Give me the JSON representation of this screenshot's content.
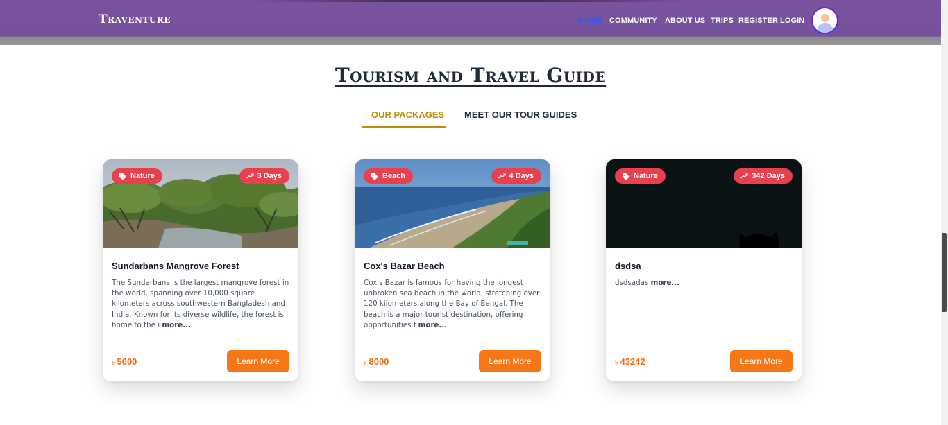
{
  "navbar": {
    "brand": "Traventure",
    "links": [
      "HOME",
      "COMMUNITY",
      "ABOUT US",
      "TRIPS",
      "REGISTER",
      "LOGIN"
    ],
    "active_link": "HOME"
  },
  "main": {
    "title": "Tourism and Travel Guide",
    "tabs": [
      {
        "label": "OUR PACKAGES",
        "active": true
      },
      {
        "label": "MEET OUR TOUR GUIDES",
        "active": false
      }
    ],
    "packages": [
      {
        "category": "Nature",
        "duration": "3 Days",
        "title": "Sundarbans Mangrove Forest",
        "description": "The Sundarbans is the largest mangrove forest in the world, spanning over 10,000 square kilometers across southwestern Bangladesh and India. Known for its diverse wildlife, the forest is home to the i",
        "more_label": "more...",
        "currency": "৳",
        "price": "5000",
        "button_label": "Learn More"
      },
      {
        "category": "Beach",
        "duration": "4 Days",
        "title": "Cox's Bazar Beach",
        "description": "Cox's Bazar is famous for having the longest unbroken sea beach in the world, stretching over 120 kilometers along the Bay of Bengal. The beach is a major tourist destination, offering opportunities f",
        "more_label": "more...",
        "currency": "৳",
        "price": "8000",
        "button_label": "Learn More"
      },
      {
        "category": "Nature",
        "duration": "342 Days",
        "title": "dsdsa",
        "description": "dsdsadas",
        "more_label": "more...",
        "currency": "৳",
        "price": "43242",
        "button_label": "Learn More"
      }
    ]
  },
  "colors": {
    "navbar_bg": "#76519b",
    "active_link": "#2f55ff",
    "accent_gold": "#c08a06",
    "badge_red": "#e8414d",
    "price_orange": "#f06a10",
    "button_orange": "#f57716"
  },
  "icons": [
    "tag-icon",
    "trending-up-icon",
    "user-avatar-icon"
  ]
}
